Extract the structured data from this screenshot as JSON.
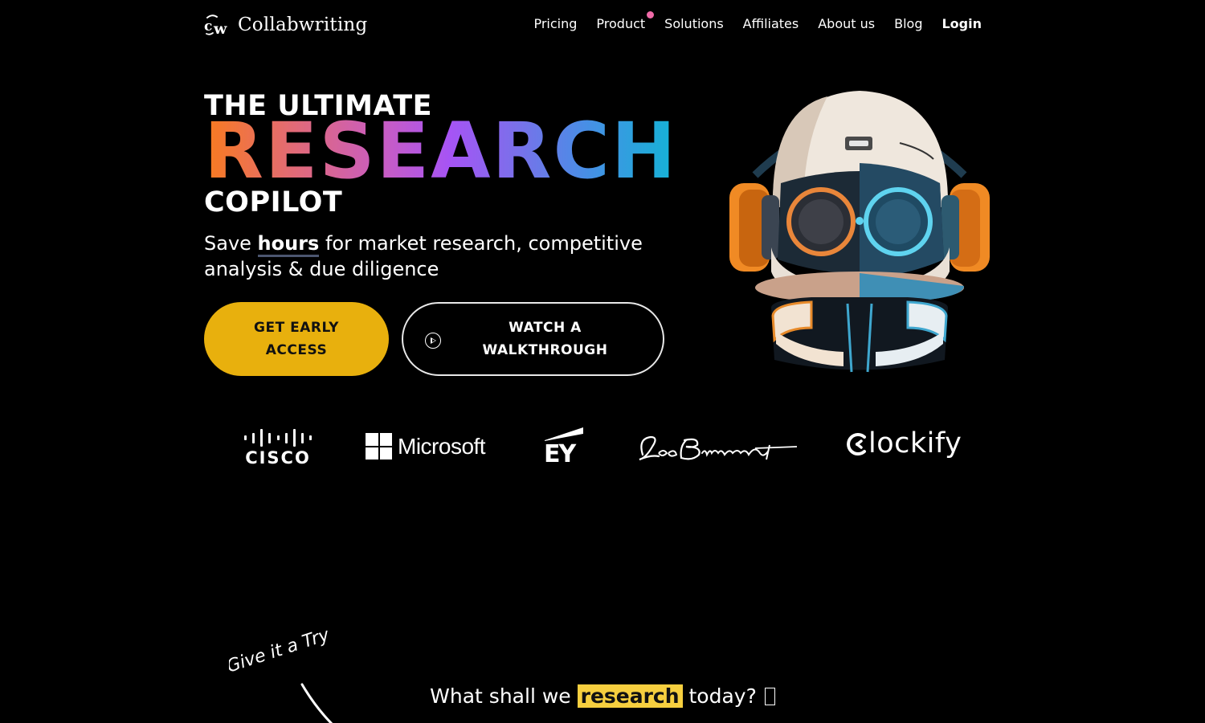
{
  "nav": {
    "brand": "Collabwriting",
    "links": [
      {
        "label": "Pricing"
      },
      {
        "label": "Product",
        "has_dot": true
      },
      {
        "label": "Solutions"
      },
      {
        "label": "Affiliates"
      },
      {
        "label": "About us"
      },
      {
        "label": "Blog"
      },
      {
        "label": "Login",
        "bold": true
      }
    ],
    "dot_color": "#f06aa8"
  },
  "hero": {
    "kicker": "THE ULTIMATE",
    "headline": "RESEARCH",
    "headline_gradient": [
      "#f97b1e",
      "#c85cc4",
      "#a654f5",
      "#4a8de6",
      "#13b4d6"
    ],
    "tagline": "COPILOT",
    "subtitle_pre": "Save ",
    "subtitle_highlight": "hours",
    "subtitle_post": " for market research, competitive analysis & due diligence",
    "primary_button": "GET EARLY ACCESS",
    "primary_color": "#e8b00d",
    "secondary_button": "WATCH A WALKTHROUGH",
    "secondary_icon": "play-circle-icon",
    "illustration": "robot-astronaut-with-headphones"
  },
  "logos": [
    "Cisco",
    "Microsoft",
    "EY",
    "Leo Burnett",
    "Clockify"
  ],
  "logo_text": {
    "cisco": "CISCO",
    "microsoft": "Microsoft",
    "ey": "EY",
    "clockify": "lockify"
  },
  "try_section": {
    "handwritten_note": "Give it a Try",
    "prompt_pre": "What shall we ",
    "prompt_highlight": "research",
    "prompt_post": " today?",
    "highlight_color": "#f6cf3f"
  }
}
